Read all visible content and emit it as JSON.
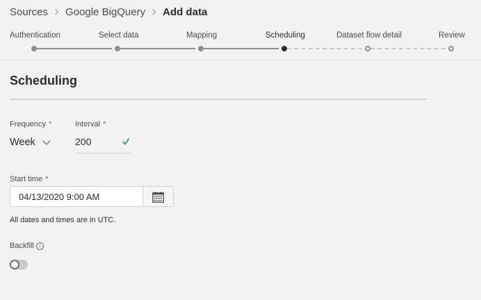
{
  "breadcrumb": {
    "items": [
      "Sources",
      "Google BigQuery"
    ],
    "current": "Add data"
  },
  "steps": [
    {
      "label": "Authentication",
      "state": "done"
    },
    {
      "label": "Select data",
      "state": "done"
    },
    {
      "label": "Mapping",
      "state": "done"
    },
    {
      "label": "Scheduling",
      "state": "current"
    },
    {
      "label": "Dataset flow detail",
      "state": "todo"
    },
    {
      "label": "Review",
      "state": "todo"
    }
  ],
  "section": {
    "title": "Scheduling"
  },
  "frequency": {
    "label": "Frequency",
    "required_mark": "*",
    "value": "Week"
  },
  "interval": {
    "label": "Interval",
    "required_mark": "*",
    "value": "200",
    "valid": true
  },
  "start_time": {
    "label": "Start time",
    "required_mark": "*",
    "value": "04/13/2020 9:00 AM",
    "note": "All dates and times are in UTC."
  },
  "backfill": {
    "label": "Backfill",
    "enabled": false
  },
  "colors": {
    "valid_check": "#2d9d78",
    "current_step": "#2c2c2c",
    "inactive": "#8e8e8e"
  }
}
